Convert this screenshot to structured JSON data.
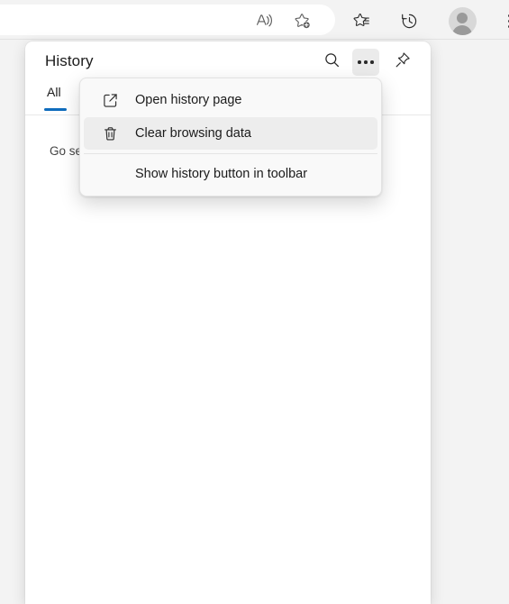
{
  "browser_toolbar": {
    "buttons": [
      {
        "name": "read-aloud",
        "icon": "read-aloud-icon",
        "tooltip": "Read this page aloud"
      },
      {
        "name": "add-favorite",
        "icon": "star-add-icon",
        "tooltip": "Add this page to favorites"
      },
      {
        "name": "favorites",
        "icon": "favorites-star-list-icon",
        "tooltip": "Favorites"
      },
      {
        "name": "history",
        "icon": "history-clock-icon",
        "tooltip": "History"
      },
      {
        "name": "profile",
        "icon": "profile-avatar-icon",
        "tooltip": "Profile"
      },
      {
        "name": "settings-and-more",
        "icon": "more-vertical-icon",
        "tooltip": "Settings and more"
      }
    ]
  },
  "history_panel": {
    "title": "History",
    "header_buttons": [
      {
        "name": "search",
        "icon": "search-icon",
        "label": "Search history"
      },
      {
        "name": "more-options",
        "icon": "more-horizontal-icon",
        "label": "More options",
        "state": "active"
      },
      {
        "name": "pin",
        "icon": "pin-icon",
        "label": "Pin this pane"
      }
    ],
    "tabs": [
      {
        "label": "All",
        "selected": true
      }
    ],
    "empty_text": "Go search history",
    "accent_color": "#0f6cbd"
  },
  "context_menu": {
    "items": [
      {
        "label": "Open history page",
        "icon": "open-external-icon",
        "hovered": false
      },
      {
        "label": "Clear browsing data",
        "icon": "trash-icon",
        "hovered": true
      },
      {
        "label": "Show history button in toolbar",
        "icon": null,
        "hovered": false
      }
    ]
  }
}
